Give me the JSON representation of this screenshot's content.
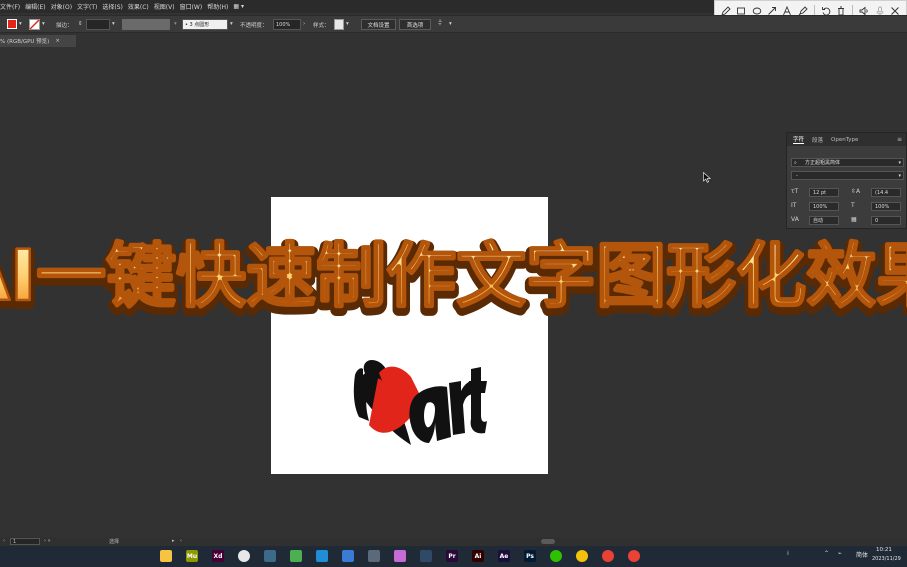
{
  "menubar": {
    "items": [
      "文件(F)",
      "编辑(E)",
      "对象(O)",
      "文字(T)",
      "选择(S)",
      "效果(C)",
      "视图(V)",
      "窗口(W)",
      "帮助(H)",
      "▦ ▾"
    ]
  },
  "controlbar": {
    "stroke_label": "描边：",
    "stroke_value": "",
    "brush_value": "• 3 点圆形",
    "opacity_label": "不透明度：",
    "opacity_value": "100%",
    "style_label": "样式：",
    "doc_setup_button": "文档设置",
    "prefs_button": "首选项",
    "colors": {
      "fill": "#e1251b"
    }
  },
  "doc_tab": {
    "title": "% (RGB/GPU 预览)",
    "close": "×"
  },
  "artboard": {
    "artwork_text": "heart",
    "artwork_colors": {
      "heart": "#e1251b",
      "text": "#111111"
    }
  },
  "overlay": {
    "title": "AI一键快速制作文字图形化效果",
    "colors": {
      "fill_top": "#fff6c0",
      "fill_bottom": "#f0871a",
      "stroke": "#7a3a05"
    }
  },
  "character_panel": {
    "tabs": [
      "字符",
      "段落",
      "OpenType"
    ],
    "font_family": "方正超粗黑简体",
    "font_style": "-",
    "font_size": "12 pt",
    "leading": "(14.4",
    "vertical_scale": "100%",
    "horizontal_scale": "100%",
    "kerning": "自动",
    "tracking": "0"
  },
  "statusbar": {
    "zoom": "1",
    "tool": "选择"
  },
  "taskbar": {
    "apps": [
      {
        "name": "explorer",
        "label": "",
        "color": "#f6c342"
      },
      {
        "name": "muse",
        "label": "Mu",
        "color": "#8c9a00"
      },
      {
        "name": "xd",
        "label": "Xd",
        "color": "#470137"
      },
      {
        "name": "app-circle",
        "label": "",
        "color": "#e8e8e8"
      },
      {
        "name": "app-arrow",
        "label": "",
        "color": "#3c6b8a"
      },
      {
        "name": "app-map",
        "label": "",
        "color": "#4caf50"
      },
      {
        "name": "edge",
        "label": "",
        "color": "#1f8ed6"
      },
      {
        "name": "calculator",
        "label": "",
        "color": "#3a7bd5"
      },
      {
        "name": "app-cloud",
        "label": "",
        "color": "#5a6a7a"
      },
      {
        "name": "app-color",
        "label": "",
        "color": "#c66bd4"
      },
      {
        "name": "app-ring",
        "label": "",
        "color": "#2e4a66"
      },
      {
        "name": "premiere",
        "label": "Pr",
        "color": "#2a0a3a"
      },
      {
        "name": "illustrator",
        "label": "Ai",
        "color": "#330000"
      },
      {
        "name": "after-effects",
        "label": "Ae",
        "color": "#1c0e3a"
      },
      {
        "name": "photoshop",
        "label": "Ps",
        "color": "#001b33"
      },
      {
        "name": "wechat",
        "label": "",
        "color": "#2dc100"
      },
      {
        "name": "app-yellow",
        "label": "",
        "color": "#f4c20d"
      },
      {
        "name": "app-flower",
        "label": "",
        "color": "#e94235"
      },
      {
        "name": "chrome",
        "label": "",
        "color": "#ea4335"
      }
    ],
    "lang": "简体",
    "time": "10:21",
    "date": "2023/11/29"
  }
}
